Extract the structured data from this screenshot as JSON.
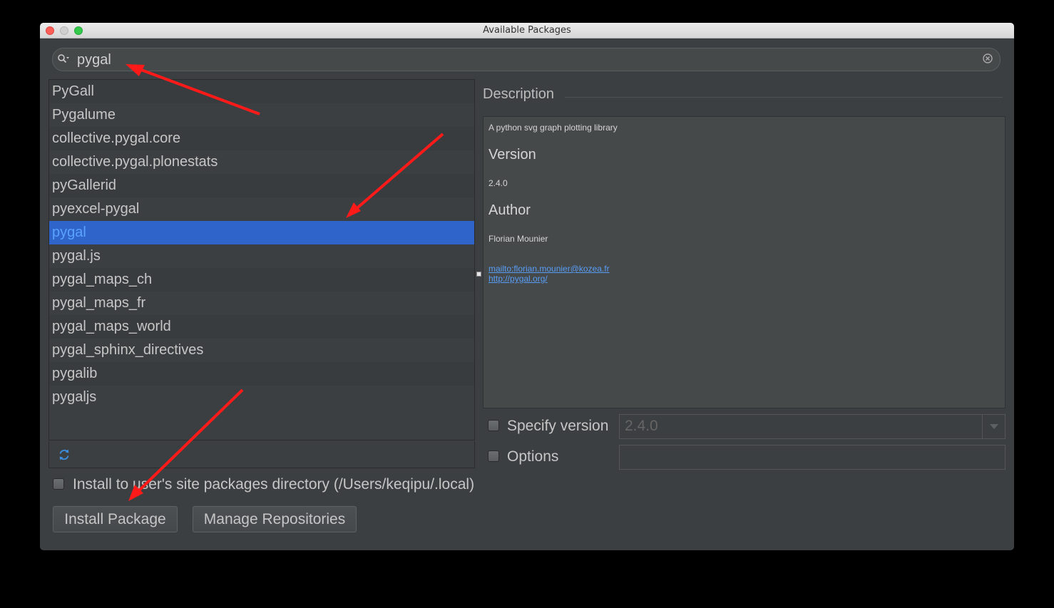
{
  "window": {
    "title": "Available Packages"
  },
  "search": {
    "value": "pygal"
  },
  "packages": [
    "PyGall",
    "Pygalume",
    "collective.pygal.core",
    "collective.pygal.plonestats",
    "pyGallerid",
    "pyexcel-pygal",
    "pygal",
    "pygal.js",
    "pygal_maps_ch",
    "pygal_maps_fr",
    "pygal_maps_world",
    "pygal_sphinx_directives",
    "pygalib",
    "pygaljs"
  ],
  "selected_package": "pygal",
  "description": {
    "title": "Description",
    "summary": "A python svg graph plotting library",
    "version_heading": "Version",
    "version": "2.4.0",
    "author_heading": "Author",
    "author": "Florian Mounier",
    "link_email": "mailto:florian.mounier@kozea.fr",
    "link_site": "http://pygal.org/"
  },
  "specify_version": {
    "label": "Specify version",
    "value": "2.4.0",
    "checked": false
  },
  "options": {
    "label": "Options",
    "value": "",
    "checked": false
  },
  "install_user": {
    "label": "Install to user's site packages directory (/Users/keqipu/.local)",
    "checked": false
  },
  "buttons": {
    "install": "Install Package",
    "manage": "Manage Repositories"
  },
  "colors": {
    "selection": "#2f65ca",
    "link": "#589df6",
    "annotation_arrow": "#ff1a1a"
  }
}
